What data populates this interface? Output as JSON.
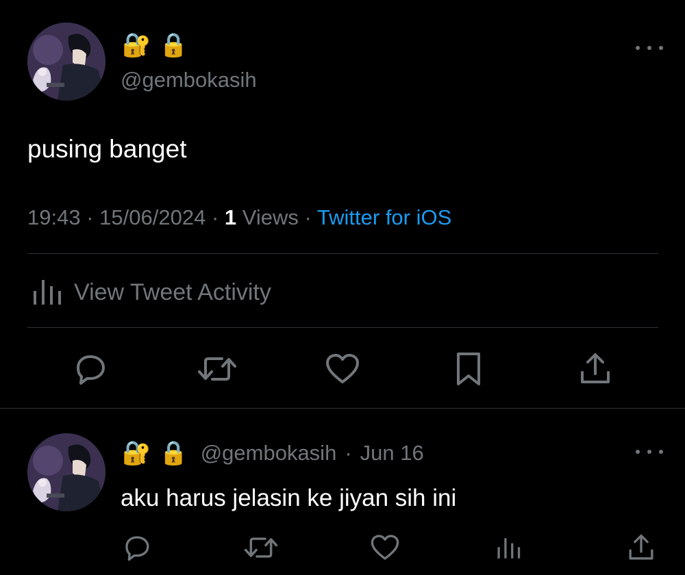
{
  "main_tweet": {
    "lock_emoji_1": "🔐",
    "lock_emoji_2": "🔒",
    "handle": "@gembokasih",
    "text": "pusing banget",
    "time": "19:43",
    "sep1": "·",
    "date": "15/06/2024",
    "sep2": "·",
    "views_count": "1",
    "views_label": "Views",
    "sep3": "·",
    "source": "Twitter for iOS",
    "activity_label": "View Tweet Activity"
  },
  "reply_tweet": {
    "lock_emoji_1": "🔐",
    "lock_emoji_2": "🔒",
    "handle": "@gembokasih",
    "sep": "·",
    "date": "Jun 16",
    "text": "aku harus jelasin ke jiyan sih ini"
  },
  "colors": {
    "background": "#000000",
    "text": "#e7e9ea",
    "muted": "#71767b",
    "link": "#1d9bf0",
    "divider": "#2f3336"
  },
  "icons": {
    "reply": "reply-icon",
    "retweet": "retweet-icon",
    "like": "heart-icon",
    "bookmark": "bookmark-icon",
    "share": "share-icon",
    "analytics": "analytics-icon",
    "more": "more-icon"
  }
}
